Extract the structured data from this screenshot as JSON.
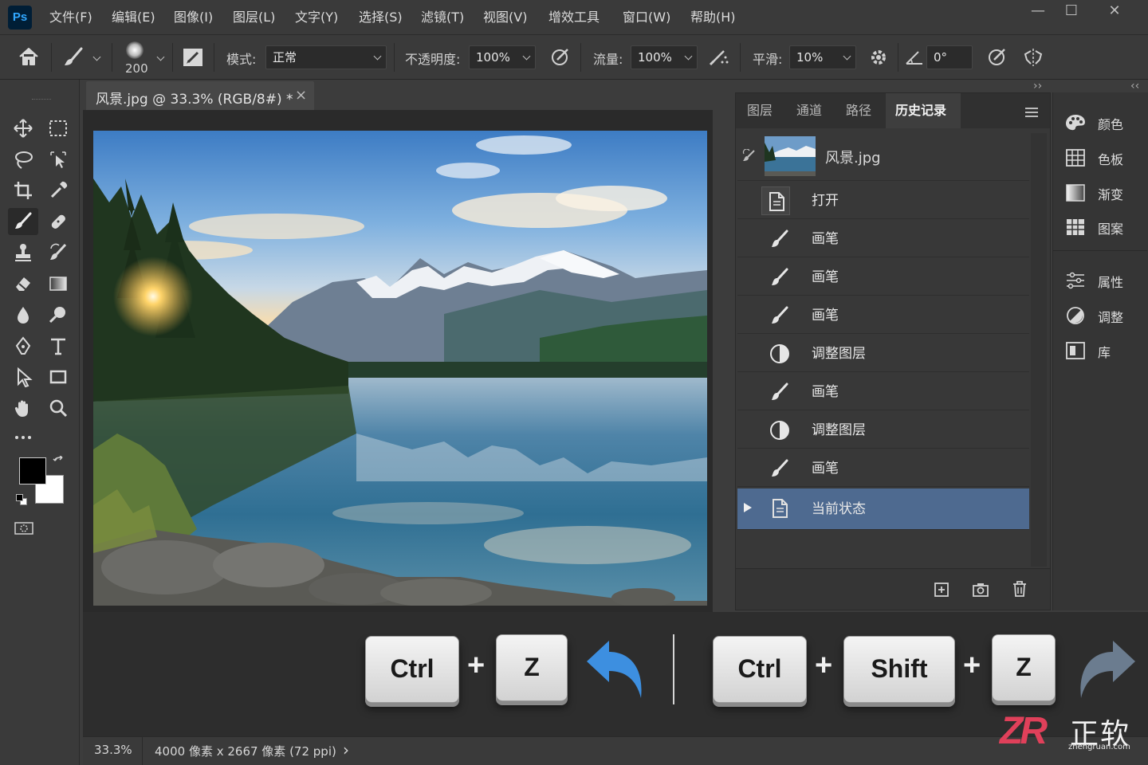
{
  "app": {
    "logo": "Ps"
  },
  "menu": [
    "文件(F)",
    "编辑(E)",
    "图像(I)",
    "图层(L)",
    "文字(Y)",
    "选择(S)",
    "滤镜(T)",
    "视图(V)",
    "增效工具",
    "窗口(W)",
    "帮助(H)"
  ],
  "window_controls": {
    "minimize": "—",
    "maximize": "☐",
    "close": "✕"
  },
  "options": {
    "brush_size": "200",
    "mode_label": "模式:",
    "mode_value": "正常",
    "opacity_label": "不透明度:",
    "opacity_value": "100%",
    "flow_label": "流量:",
    "flow_value": "100%",
    "smoothing_label": "平滑:",
    "smoothing_value": "10%",
    "angle_value": "0°"
  },
  "panel_collapse": {
    "left": "‹‹",
    "mid": "››",
    "right": "‹‹"
  },
  "document": {
    "tab_title": "风景.jpg @ 33.3% (RGB/8#) *",
    "close": "×"
  },
  "history_panel": {
    "tabs": [
      "图层",
      "通道",
      "路径",
      "历史记录"
    ],
    "active_tab": "历史记录",
    "snapshot_name": "风景.jpg",
    "items": [
      {
        "label": "打开",
        "icon": "document-icon"
      },
      {
        "label": "画笔",
        "icon": "brush-icon"
      },
      {
        "label": "画笔",
        "icon": "brush-icon"
      },
      {
        "label": "画笔",
        "icon": "brush-icon"
      },
      {
        "label": "调整图层",
        "icon": "adjustment-icon"
      },
      {
        "label": "画笔",
        "icon": "brush-icon"
      },
      {
        "label": "调整图层",
        "icon": "adjustment-icon"
      },
      {
        "label": "画笔",
        "icon": "brush-icon"
      },
      {
        "label": "当前状态",
        "icon": "document-icon",
        "selected": true
      }
    ],
    "colors": {
      "selected_row": "#4e6a90"
    }
  },
  "right_panels": {
    "group1": [
      "颜色",
      "色板",
      "渐变",
      "图案"
    ],
    "group2": [
      "属性",
      "调整",
      "库"
    ]
  },
  "shortcuts": {
    "undo": {
      "keys": [
        "Ctrl",
        "Z"
      ],
      "arrow_color": "#3d8fe0"
    },
    "redo": {
      "keys": [
        "Ctrl",
        "Shift",
        "Z"
      ],
      "arrow_color": "#6b7c8f"
    },
    "plus": "+"
  },
  "status": {
    "zoom": "33.3%",
    "doc_info": "4000 像素 x 2667 像素 (72 ppi)",
    "arrow": "›"
  },
  "watermark": {
    "logo": "ZR",
    "name": "正软",
    "url": "zhengruan.com"
  }
}
